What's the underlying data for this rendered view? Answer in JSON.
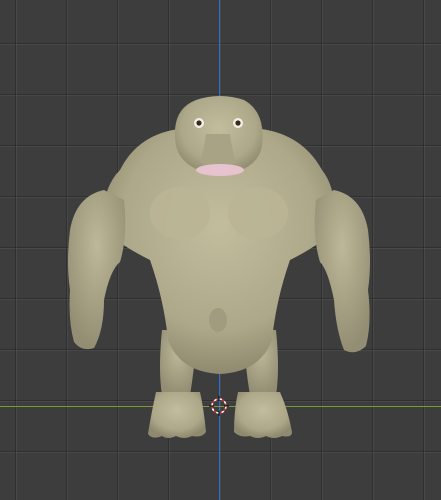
{
  "viewport": {
    "mode": "3d-viewport",
    "object": "creature-sculpt",
    "colors": {
      "background": "#3d3d3d",
      "axis_z": "#2f6fd0",
      "axis_y": "#7a9a3a",
      "model_skin": "#b5b091"
    },
    "icons": {
      "cursor": "3d-cursor-icon"
    }
  }
}
